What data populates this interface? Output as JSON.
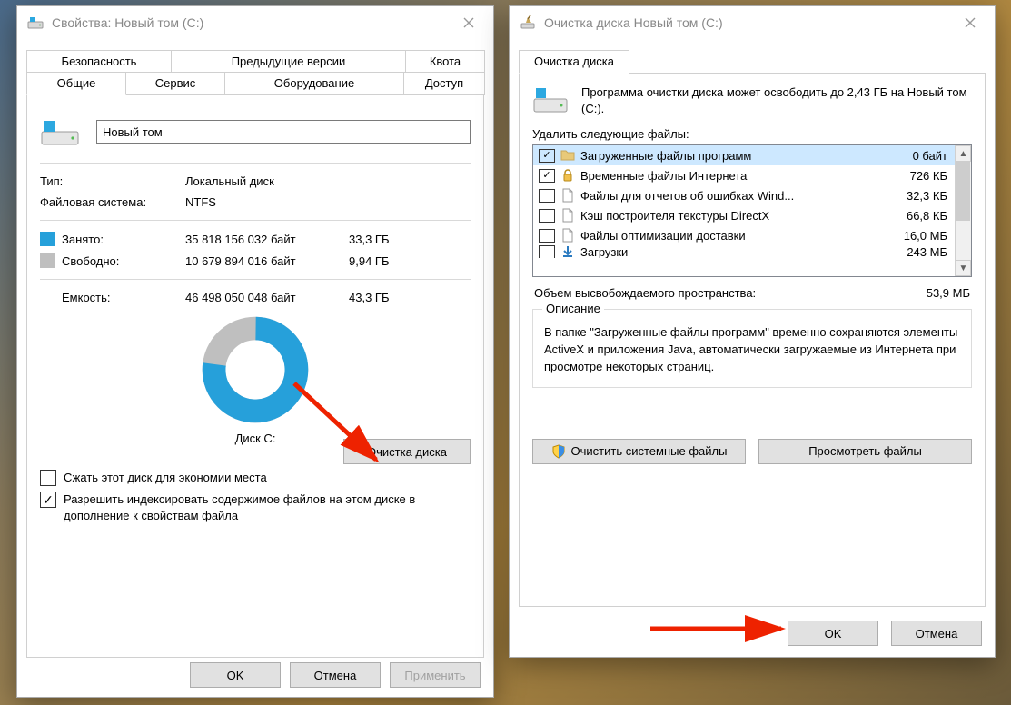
{
  "left_window": {
    "title": "Свойства: Новый том (C:)",
    "tabs_back": [
      "Безопасность",
      "Предыдущие версии",
      "Квота"
    ],
    "tabs_front": [
      "Общие",
      "Сервис",
      "Оборудование",
      "Доступ"
    ],
    "active_tab": "Общие",
    "drive_name": "Новый том",
    "type_label": "Тип:",
    "type_value": "Локальный диск",
    "fs_label": "Файловая система:",
    "fs_value": "NTFS",
    "used_label": "Занято:",
    "used_bytes": "35 818 156 032 байт",
    "used_gb": "33,3 ГБ",
    "free_label": "Свободно:",
    "free_bytes": "10 679 894 016 байт",
    "free_gb": "9,94 ГБ",
    "cap_label": "Емкость:",
    "cap_bytes": "46 498 050 048 байт",
    "cap_gb": "43,3 ГБ",
    "disk_label": "Диск C:",
    "cleanup_button": "Очистка диска",
    "compress_label": "Сжать этот диск для экономии места",
    "index_label": "Разрешить индексировать содержимое файлов на этом диске в дополнение к свойствам файла",
    "footer": {
      "ok": "OK",
      "cancel": "Отмена",
      "apply": "Применить"
    }
  },
  "right_window": {
    "title": "Очистка диска Новый том (C:)",
    "tab": "Очистка диска",
    "intro": "Программа очистки диска может освободить до 2,43 ГБ на Новый том (C:).",
    "files_label": "Удалить следующие файлы:",
    "items": [
      {
        "checked": true,
        "icon": "folder",
        "name": "Загруженные файлы программ",
        "size": "0 байт",
        "selected": true
      },
      {
        "checked": true,
        "icon": "lock",
        "name": "Временные файлы Интернета",
        "size": "726 КБ",
        "selected": false
      },
      {
        "checked": false,
        "icon": "file",
        "name": "Файлы для отчетов об ошибках Wind...",
        "size": "32,3 КБ",
        "selected": false
      },
      {
        "checked": false,
        "icon": "file",
        "name": "Кэш построителя текстуры DirectX",
        "size": "66,8 КБ",
        "selected": false
      },
      {
        "checked": false,
        "icon": "file",
        "name": "Файлы оптимизации доставки",
        "size": "16,0 МБ",
        "selected": false
      },
      {
        "checked": false,
        "icon": "down",
        "name": "Загрузки",
        "size": "243 МБ",
        "selected": false
      }
    ],
    "freed_label": "Объем высвобождаемого пространства:",
    "freed_value": "53,9 МБ",
    "desc_title": "Описание",
    "desc_text": "В папке \"Загруженные файлы программ\" временно сохраняются элементы ActiveX и приложения Java, автоматически загружаемые из Интернета при просмотре некоторых страниц.",
    "clean_system": "Очистить системные файлы",
    "view_files": "Просмотреть файлы",
    "footer": {
      "ok": "OK",
      "cancel": "Отмена"
    }
  },
  "chart_data": {
    "type": "pie",
    "title": "Диск C:",
    "categories": [
      "Занято",
      "Свободно"
    ],
    "values": [
      35818156032,
      10679894016
    ],
    "colors": [
      "#26a0da",
      "#bfbfbf"
    ]
  }
}
